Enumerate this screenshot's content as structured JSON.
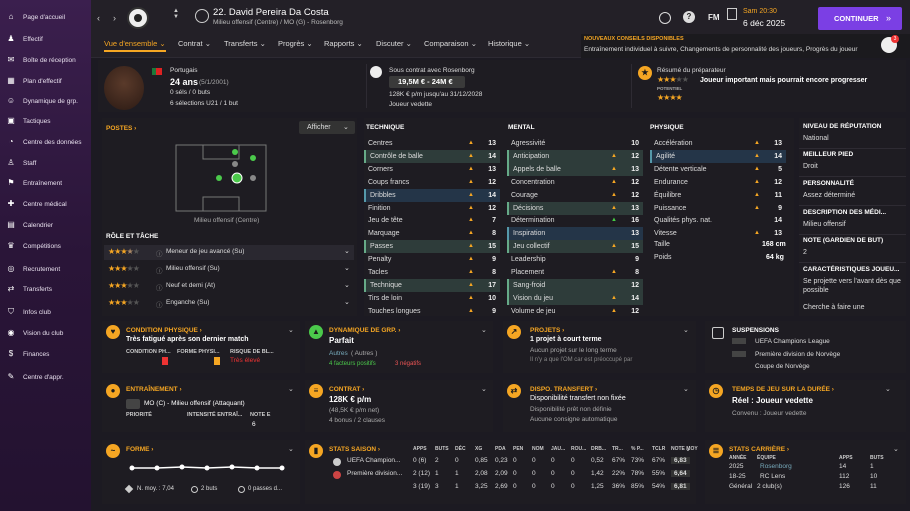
{
  "sidebar": {
    "items": [
      {
        "label": "Page d'accueil",
        "icon": "home-icon"
      },
      {
        "label": "Effectif",
        "icon": "person-icon"
      },
      {
        "label": "Boîte de réception",
        "icon": "mail-icon"
      },
      {
        "label": "Plan d'effectif",
        "icon": "plan-icon"
      },
      {
        "label": "Dynamique de grp.",
        "icon": "group-icon"
      },
      {
        "label": "Tactiques",
        "icon": "tactics-icon"
      },
      {
        "label": "Centre des données",
        "icon": "data-icon"
      },
      {
        "label": "Staff",
        "icon": "staff-icon"
      },
      {
        "label": "Entraînement",
        "icon": "training-icon"
      },
      {
        "label": "Centre médical",
        "icon": "medical-icon"
      },
      {
        "label": "Calendrier",
        "icon": "calendar-icon"
      },
      {
        "label": "Compétitions",
        "icon": "trophy-icon"
      },
      {
        "label": "Recrutement",
        "icon": "scouting-icon"
      },
      {
        "label": "Transferts",
        "icon": "transfer-icon"
      },
      {
        "label": "Infos club",
        "icon": "club-icon"
      },
      {
        "label": "Vision du club",
        "icon": "vision-icon"
      },
      {
        "label": "Finances",
        "icon": "finance-icon"
      },
      {
        "label": "Centre d'appr.",
        "icon": "learning-icon"
      }
    ]
  },
  "header": {
    "player_name": "22. David Pereira Da Costa",
    "player_sub": "Milieu offensif (Centre) / MO (G) - Rosenborg",
    "fm": "FM",
    "day": "Sam 20:30",
    "date": "6 déc 2025",
    "continue": "CONTINUER",
    "news_title": "NOUVEAUX CONSEILS DISPONIBLES",
    "news_text": "Entraînement individuel à suivre, Changements de personnalité des joueurs, Progrès du joueur",
    "badge": "3",
    "tabs": [
      "Vue d'ensemble",
      "Contrat",
      "Transferts",
      "Progrès",
      "Rapports",
      "Discuter",
      "Comparaison",
      "Historique"
    ]
  },
  "profile": {
    "nation": "Portugais",
    "age": "24 ans",
    "dob": "(5/1/2001)",
    "caps": "0 séls / 0 buts",
    "u21": "6 sélections U21 / 1 but",
    "contract": "Sous contrat avec Rosenborg",
    "value": "19,5M € - 24M €",
    "wage": "128K € p/m jusqu'au 31/12/2028",
    "status": "Joueur vedette",
    "coach_title": "Résumé du préparateur",
    "coach_text": "Joueur important mais pourrait encore progresser",
    "potentiel": "POTENTIEL"
  },
  "positions": {
    "title": "POSTES",
    "show": "Afficher",
    "caption": "Milieu offensif (Centre)"
  },
  "roles": {
    "title": "RÔLE ET TÂCHE",
    "items": [
      {
        "label": "Meneur de jeu avancé (Su)",
        "stars": 3.5
      },
      {
        "label": "Milieu offensif (Su)",
        "stars": 3
      },
      {
        "label": "Neuf et demi (At)",
        "stars": 3
      },
      {
        "label": "Enganche (Su)",
        "stars": 3
      }
    ]
  },
  "technique": {
    "title": "TECHNIQUE",
    "rows": [
      [
        "Centres",
        "13"
      ],
      [
        "Contrôle de balle",
        "14"
      ],
      [
        "Corners",
        "13"
      ],
      [
        "Coups francs",
        "12"
      ],
      [
        "Dribbles",
        "14"
      ],
      [
        "Finition",
        "12"
      ],
      [
        "Jeu de tête",
        "7"
      ],
      [
        "Marquage",
        "8"
      ],
      [
        "Passes",
        "15"
      ],
      [
        "Penalty",
        "9"
      ],
      [
        "Tacles",
        "8"
      ],
      [
        "Technique",
        "17"
      ],
      [
        "Tirs de loin",
        "10"
      ],
      [
        "Touches longues",
        "9"
      ]
    ]
  },
  "mental": {
    "title": "MENTAL",
    "rows": [
      [
        "Agressivité",
        "10"
      ],
      [
        "Anticipation",
        "12"
      ],
      [
        "Appels de balle",
        "13"
      ],
      [
        "Concentration",
        "12"
      ],
      [
        "Courage",
        "12"
      ],
      [
        "Décisions",
        "13"
      ],
      [
        "Détermination",
        "16"
      ],
      [
        "Inspiration",
        "13"
      ],
      [
        "Jeu collectif",
        "15"
      ],
      [
        "Leadership",
        "9"
      ],
      [
        "Placement",
        "8"
      ],
      [
        "Sang-froid",
        "12"
      ],
      [
        "Vision du jeu",
        "14"
      ],
      [
        "Volume de jeu",
        "12"
      ]
    ]
  },
  "physique": {
    "title": "PHYSIQUE",
    "rows": [
      [
        "Accélération",
        "13"
      ],
      [
        "Agilité",
        "14"
      ],
      [
        "Détente verticale",
        "5"
      ],
      [
        "Endurance",
        "12"
      ],
      [
        "Équilibre",
        "11"
      ],
      [
        "Puissance",
        "9"
      ],
      [
        "Qualités phys. nat.",
        "14"
      ],
      [
        "Vitesse",
        "13"
      ]
    ],
    "height_label": "Taille",
    "height": "168 cm",
    "weight_label": "Poids",
    "weight": "64 kg"
  },
  "info": [
    {
      "title": "NIVEAU DE RÉPUTATION",
      "value": "National"
    },
    {
      "title": "MEILLEUR PIED",
      "value": "Droit"
    },
    {
      "title": "PERSONNALITÉ",
      "value": "Assez déterminé"
    },
    {
      "title": "DESCRIPTION DES MÉDI...",
      "value": "Milieu offensif"
    },
    {
      "title": "NOTE (GARDIEN DE BUT)",
      "value": "2"
    },
    {
      "title": "CARACTÉRISTIQUES JOUEU...",
      "value": "Se projette vers l'avant dès que possible"
    },
    {
      "title": "",
      "value": "Cherche à faire une"
    }
  ],
  "cards": {
    "condition": {
      "title": "CONDITION PHYSIQUE",
      "text": "Très fatigué après son dernier match",
      "l1": "CONDITION PH...",
      "l2": "FORME PHYSI...",
      "l3": "RISQUE DE BL...",
      "risk": "Très élevé"
    },
    "dynamique": {
      "title": "DYNAMIQUE DE GRP.",
      "text": "Parfait",
      "autres": "Autres",
      "autres2": "( Autres )",
      "pos": "4 facteurs positifs",
      "neg": "3 négatifs"
    },
    "projets": {
      "title": "PROJETS",
      "text": "1 projet à court terme",
      "t1": "Aucun projet sur le long terme",
      "t2": "Il n'y a que l'OM car est préoccupé par"
    },
    "suspensions": {
      "title": "SUSPENSIONS",
      "l1": "UEFA Champions League",
      "l2": "Première division de Norvège",
      "l3": "Coupe de Norvège"
    },
    "entrainement": {
      "title": "ENTRAÎNEMENT",
      "text": "MO (C) - Milieu offensif (Attaquant)",
      "c1": "PRIORITÉ",
      "c2": "INTENSITÉ ENTRAÎ...",
      "c3": "NOTE E",
      "v3": "6"
    },
    "contrat": {
      "title": "CONTRAT",
      "text": "128K € p/m",
      "sub": "(48,5K € p/m net)",
      "sub2": "4 bonus / 2 clauses"
    },
    "dispo": {
      "title": "DISPO. TRANSFERT",
      "text": "Disponibilité transfert non fixée",
      "t1": "Disponibilité prêt non définie",
      "t2": "Aucune consigne automatique"
    },
    "temps": {
      "title": "TEMPS DE JEU SUR LA DURÉE",
      "text": "Réel : Joueur vedette",
      "sub": "Convenu : Joueur vedette"
    },
    "forme": {
      "title": "FORME",
      "s1": "N. moy. : 7,04",
      "s2": "2 buts",
      "s3": "0 passes d..."
    }
  },
  "stats_saison": {
    "title": "STATS SAISON",
    "headers": [
      "APPS",
      "BUTS",
      "DÉC",
      "XG",
      "PDA",
      "PEN",
      "NOM",
      "JAU...",
      "ROU...",
      "DRB...",
      "TR...",
      "% P...",
      "TCLR",
      "NOTE MOY"
    ],
    "rows": [
      {
        "comp": "UEFA Champion...",
        "vals": [
          "0 (6)",
          "2",
          "0",
          "0,85",
          "0,23",
          "0",
          "0",
          "0",
          "0",
          "0,52",
          "67%",
          "73%",
          "67%",
          "6,83"
        ]
      },
      {
        "comp": "Première division...",
        "vals": [
          "2 (12)",
          "1",
          "1",
          "2,08",
          "2,09",
          "0",
          "0",
          "0",
          "0",
          "1,42",
          "22%",
          "78%",
          "55%",
          "6,64"
        ]
      },
      {
        "comp": "",
        "vals": [
          "3 (19)",
          "3",
          "1",
          "3,25",
          "2,69",
          "0",
          "0",
          "0",
          "0",
          "1,25",
          "36%",
          "85%",
          "54%",
          "6,81"
        ]
      }
    ]
  },
  "stats_carriere": {
    "title": "STATS CARRIÈRE",
    "headers": [
      "ANNÉE",
      "ÉQUIPE",
      "APPS",
      "BUTS"
    ],
    "rows": [
      [
        "2025",
        "Rosenborg",
        "14",
        "1"
      ],
      [
        "18-25",
        "RC Lens",
        "112",
        "10"
      ],
      [
        "Général",
        "2 club(s)",
        "126",
        "11"
      ]
    ]
  },
  "colors": {
    "accent": "#f5a623",
    "positive": "#4bc94b",
    "purple": "#7b3fe4"
  },
  "chart_data": {
    "type": "line",
    "series": [
      {
        "values": [
          7.0,
          7.0,
          7.1,
          7.0,
          7.1,
          7.0,
          7.0
        ]
      }
    ]
  }
}
